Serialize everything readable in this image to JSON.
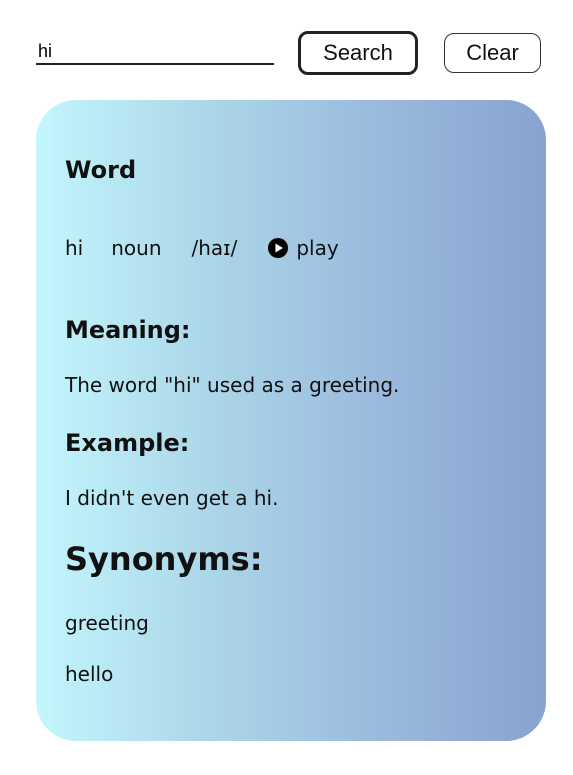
{
  "search": {
    "value": "hi",
    "search_label": "Search",
    "clear_label": "Clear"
  },
  "card": {
    "word_heading": "Word",
    "word": "hi",
    "part_of_speech": "noun",
    "phonetic": "/haɪ/",
    "play_label": "play",
    "play_icon": "play-circle-icon",
    "meaning_heading": "Meaning:",
    "meaning": "The word \"hi\" used as a greeting.",
    "example_heading": "Example:",
    "example": "I didn't even get a hi.",
    "synonyms_heading": "Synonyms:",
    "synonyms": [
      "greeting",
      "hello"
    ]
  },
  "colors": {
    "gradient_start": "#c3f6fd",
    "gradient_end": "#87a3cf"
  }
}
